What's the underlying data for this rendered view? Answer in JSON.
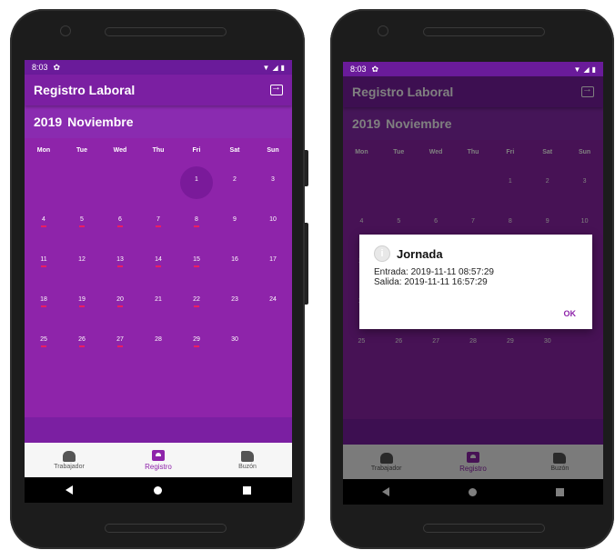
{
  "status": {
    "time": "8:03"
  },
  "app": {
    "title": "Registro Laboral"
  },
  "month": {
    "year": "2019",
    "name": "Noviembre"
  },
  "weekdays": [
    "Mon",
    "Tue",
    "Wed",
    "Thu",
    "Fri",
    "Sat",
    "Sun"
  ],
  "weeks": [
    [
      "",
      "",
      "",
      "",
      "1",
      "2",
      "3"
    ],
    [
      "4",
      "5",
      "6",
      "7",
      "8",
      "9",
      "10"
    ],
    [
      "11",
      "12",
      "13",
      "14",
      "15",
      "16",
      "17"
    ],
    [
      "18",
      "19",
      "20",
      "21",
      "22",
      "23",
      "24"
    ],
    [
      "25",
      "26",
      "27",
      "28",
      "29",
      "30",
      ""
    ]
  ],
  "nav": {
    "worker": "Trabajador",
    "registro": "Registro",
    "buzon": "Buzón"
  },
  "dialog": {
    "title": "Jornada",
    "entrada": "Entrada: 2019-11-11 08:57:29",
    "salida": "Salida: 2019-11-11 16:57:29",
    "ok": "OK"
  },
  "colors": {
    "primary": "#7b1fa2",
    "accent": "#e91e63"
  }
}
